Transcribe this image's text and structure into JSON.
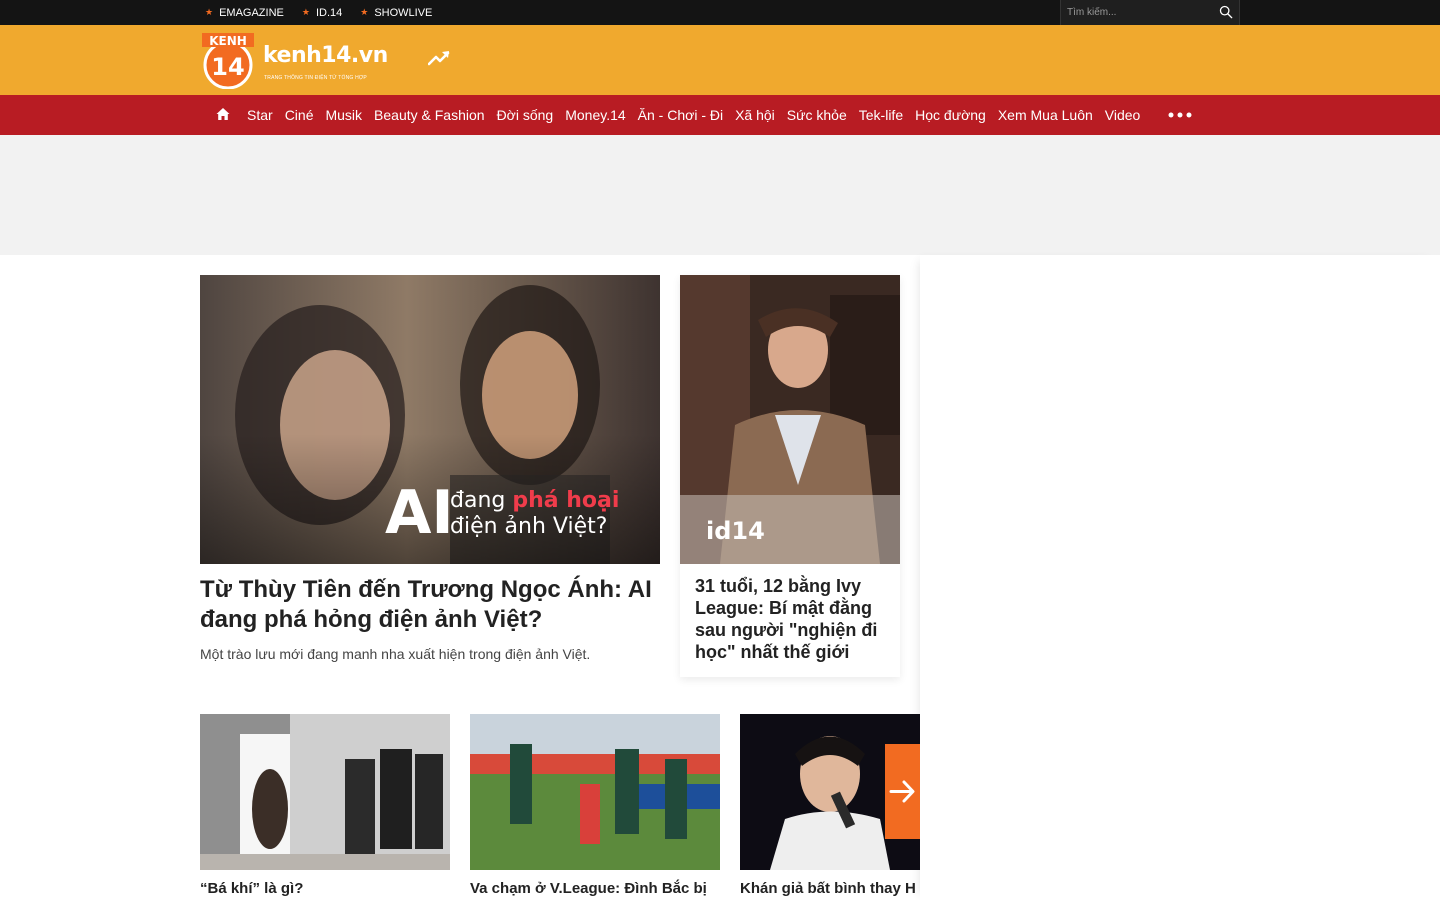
{
  "topbar": {
    "links": [
      "EMAGAZINE",
      "ID.14",
      "SHOWLIVE"
    ],
    "search_placeholder": "Tìm kiếm..."
  },
  "header": {
    "logo_badge_top": "KENH",
    "logo_badge_num": "14",
    "logo_wordmark": "kenh14.vn",
    "logo_tagline": "TRANG THÔNG TIN ĐIỆN TỬ TỔNG HỢP"
  },
  "nav": {
    "items": [
      "Star",
      "Ciné",
      "Musik",
      "Beauty & Fashion",
      "Đời sống",
      "Money.14",
      "Ăn - Chơi - Đi",
      "Xã hội",
      "Sức khỏe",
      "Tek-life",
      "Học đường",
      "Xem Mua Luôn",
      "Video"
    ]
  },
  "featured": {
    "title": "Từ Thùy Tiên đến Trương Ngọc Ánh: AI đang phá hỏng điện ảnh Việt?",
    "sapo": "Một trào lưu mới đang manh nha xuất hiện trong điện ảnh Việt.",
    "overlay_ai": "AI",
    "overlay_line1_a": "đang ",
    "overlay_line1_b": "phá hoại",
    "overlay_line2": "điện ảnh Việt?"
  },
  "side": {
    "title": "31 tuổi, 12 bằng Ivy League: Bí mật đằng sau người \"nghiện đi học\" nhất thế giới",
    "watermark": "id14"
  },
  "cards": [
    {
      "title": "“Bá khí” là gì?"
    },
    {
      "title": "Va chạm ở V.League: Đình Bắc bị"
    },
    {
      "title": "Khán giả bất bình thay H"
    }
  ],
  "colors": {
    "topbar": "#141414",
    "header": "#f0a92e",
    "nav": "#b81c23",
    "accent": "#f26b21"
  }
}
